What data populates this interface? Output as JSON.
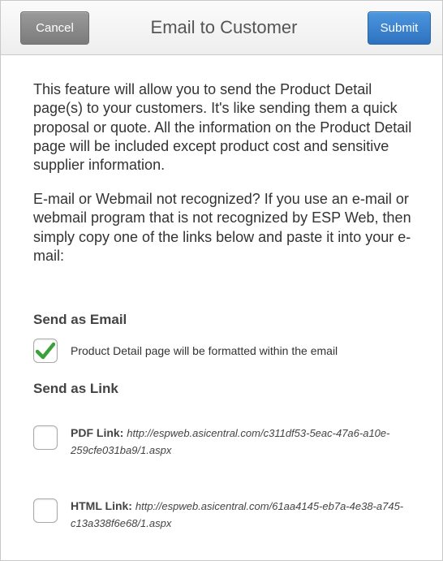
{
  "navbar": {
    "cancel_label": "Cancel",
    "title": "Email to Customer",
    "submit_label": "Submit"
  },
  "intro": {
    "paragraph1": "This feature will allow you to send the Product Detail page(s) to your customers. It's like sending them a quick proposal or quote. All the information on the Product Detail page will be included except product cost and sensitive supplier information.",
    "paragraph2": "E-mail or Webmail not recognized? If you use an e-mail or webmail program that is not recognized by ESP Web, then simply copy one of the links below and paste it into your e-mail:"
  },
  "send_as_email": {
    "heading": "Send as Email",
    "option_label": "Product Detail page will be formatted within the email",
    "checked": true
  },
  "send_as_link": {
    "heading": "Send as Link",
    "pdf": {
      "label": "PDF Link:",
      "url": "http://espweb.asicentral.com/c311df53-5eac-47a6-a10e-259cfe031ba9/1.aspx",
      "checked": false
    },
    "html": {
      "label": "HTML Link:",
      "url": "http://espweb.asicentral.com/61aa4145-eb7a-4e38-a745-c13a338f6e68/1.aspx",
      "checked": false
    }
  },
  "colors": {
    "check_green": "#3aa03a",
    "submit_blue": "#3a82d0",
    "cancel_gray": "#8a8a8a"
  },
  "icons": {
    "checkmark": "checkmark-icon"
  }
}
